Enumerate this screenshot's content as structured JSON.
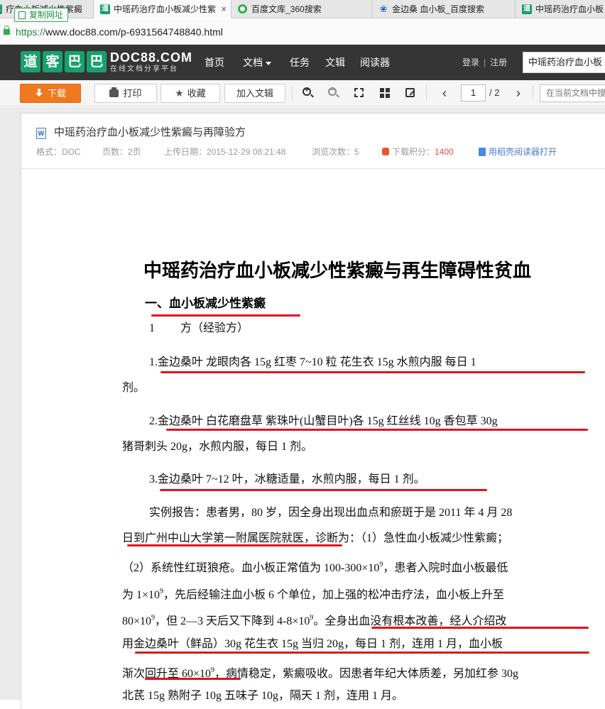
{
  "browser": {
    "tabs": [
      {
        "title": "疗血小板减少性紫癜",
        "favicon": "doc88-icon",
        "active": false
      },
      {
        "title": "中瑶药治疗血小板减少性紫",
        "favicon": "doc88-icon",
        "active": true,
        "close": "×"
      },
      {
        "title": "百度文库_360搜索",
        "favicon": "360-search-icon",
        "active": false
      },
      {
        "title": "金边桑 血小板_百度搜索",
        "favicon": "baidu-paw-icon",
        "active": false
      },
      {
        "title": "中瑶药治疗血小板",
        "favicon": "doc88-icon",
        "active": false
      }
    ],
    "copy_url_label": "复制网址",
    "url_scheme": "https://",
    "url_rest": "www.doc88.com/p-6931564748840.html"
  },
  "site": {
    "logo_cn": [
      "道",
      "客",
      "巴",
      "巴"
    ],
    "logo_en": "DOC88.COM",
    "logo_sub": "在线文档分享平台",
    "nav": [
      "首页",
      "文档",
      "任务",
      "文辑",
      "阅读器"
    ],
    "login": "登录",
    "register": "注册",
    "search_value": "中瑶药治疗血小板"
  },
  "toolbar": {
    "download": "下载",
    "print": "打印",
    "favorite": "收藏",
    "add_to_collection": "加入文辑",
    "page_current": "1",
    "page_total": "/ 2",
    "doc_search_placeholder": "在当前文档中搜索"
  },
  "docinfo": {
    "title": "中瑶药治疗血小板减少性紫癜与再障验方",
    "format": "格式：DOC",
    "pages": "页数：2页",
    "upload_date": "上传日期：2015-12-29 08:21:48",
    "views": "浏览次数：5",
    "score_label": "下载积分：",
    "score_value": "1400",
    "open_with": "用稻壳阅读器打开"
  },
  "doc": {
    "heading": "中瑶药治疗血小板减少性紫癜与再生障碍性贫血",
    "section1": "一、血小板减少性紫癜",
    "lines": [
      "1　　 方（经验方）",
      "1.金边桑叶  龙眼肉各 15g  红枣 7~10 粒    花生衣  15g  水煎内服  每日 1",
      "剂。",
      "2.金边桑叶  白花磨盘草  紫珠叶(山蟹目叶)各 15g  红丝线 10g  香包草 30g",
      "猪哥刺头 20g，水煎内服，每日 1 剂。",
      "3.金边桑叶 7~12 叶，冰糖适量，水煎内服，每日 1 剂。",
      "实例报告：患者男，80 岁，因全身出现出血点和瘀斑于是 2011 年 4 月 28",
      "日到广州中山大学第一附属医院就医，诊断为：（1）急性血小板减少性紫癜；",
      "（2）系统性红斑狼疮。血小板正常值为 100-300×10",
      "为 1×10",
      "80×10",
      "用金边桑叶（鲜品）30g  花生衣 15g  当归 20g，每日 1 剂，连用 1 月，血小板",
      "渐次回升至 60×10",
      "北芪 15g   熟附子 10g  五味子 10g，隔天 1 剂，连用 1 月。"
    ],
    "sup9": "9",
    "line9_tail": "，患者入院时血小板最低",
    "line10_tail": "，先后经输注血小板 6 个单位，加上强的松冲击疗法，血小板上升至",
    "line11_mid": "，但 2—3 天后又下降到 4-8×10",
    "line11_tail": "。全身出血没有根本改善，经人介绍改",
    "line13_tail": "，病情稳定，紫癜吸收。因患者年纪大体质差，另加红参 30g"
  },
  "colors": {
    "underline": "#e0141f",
    "brand_green": "#17a26d",
    "download_orange": "#f0781e",
    "header_bg": "#353535"
  }
}
